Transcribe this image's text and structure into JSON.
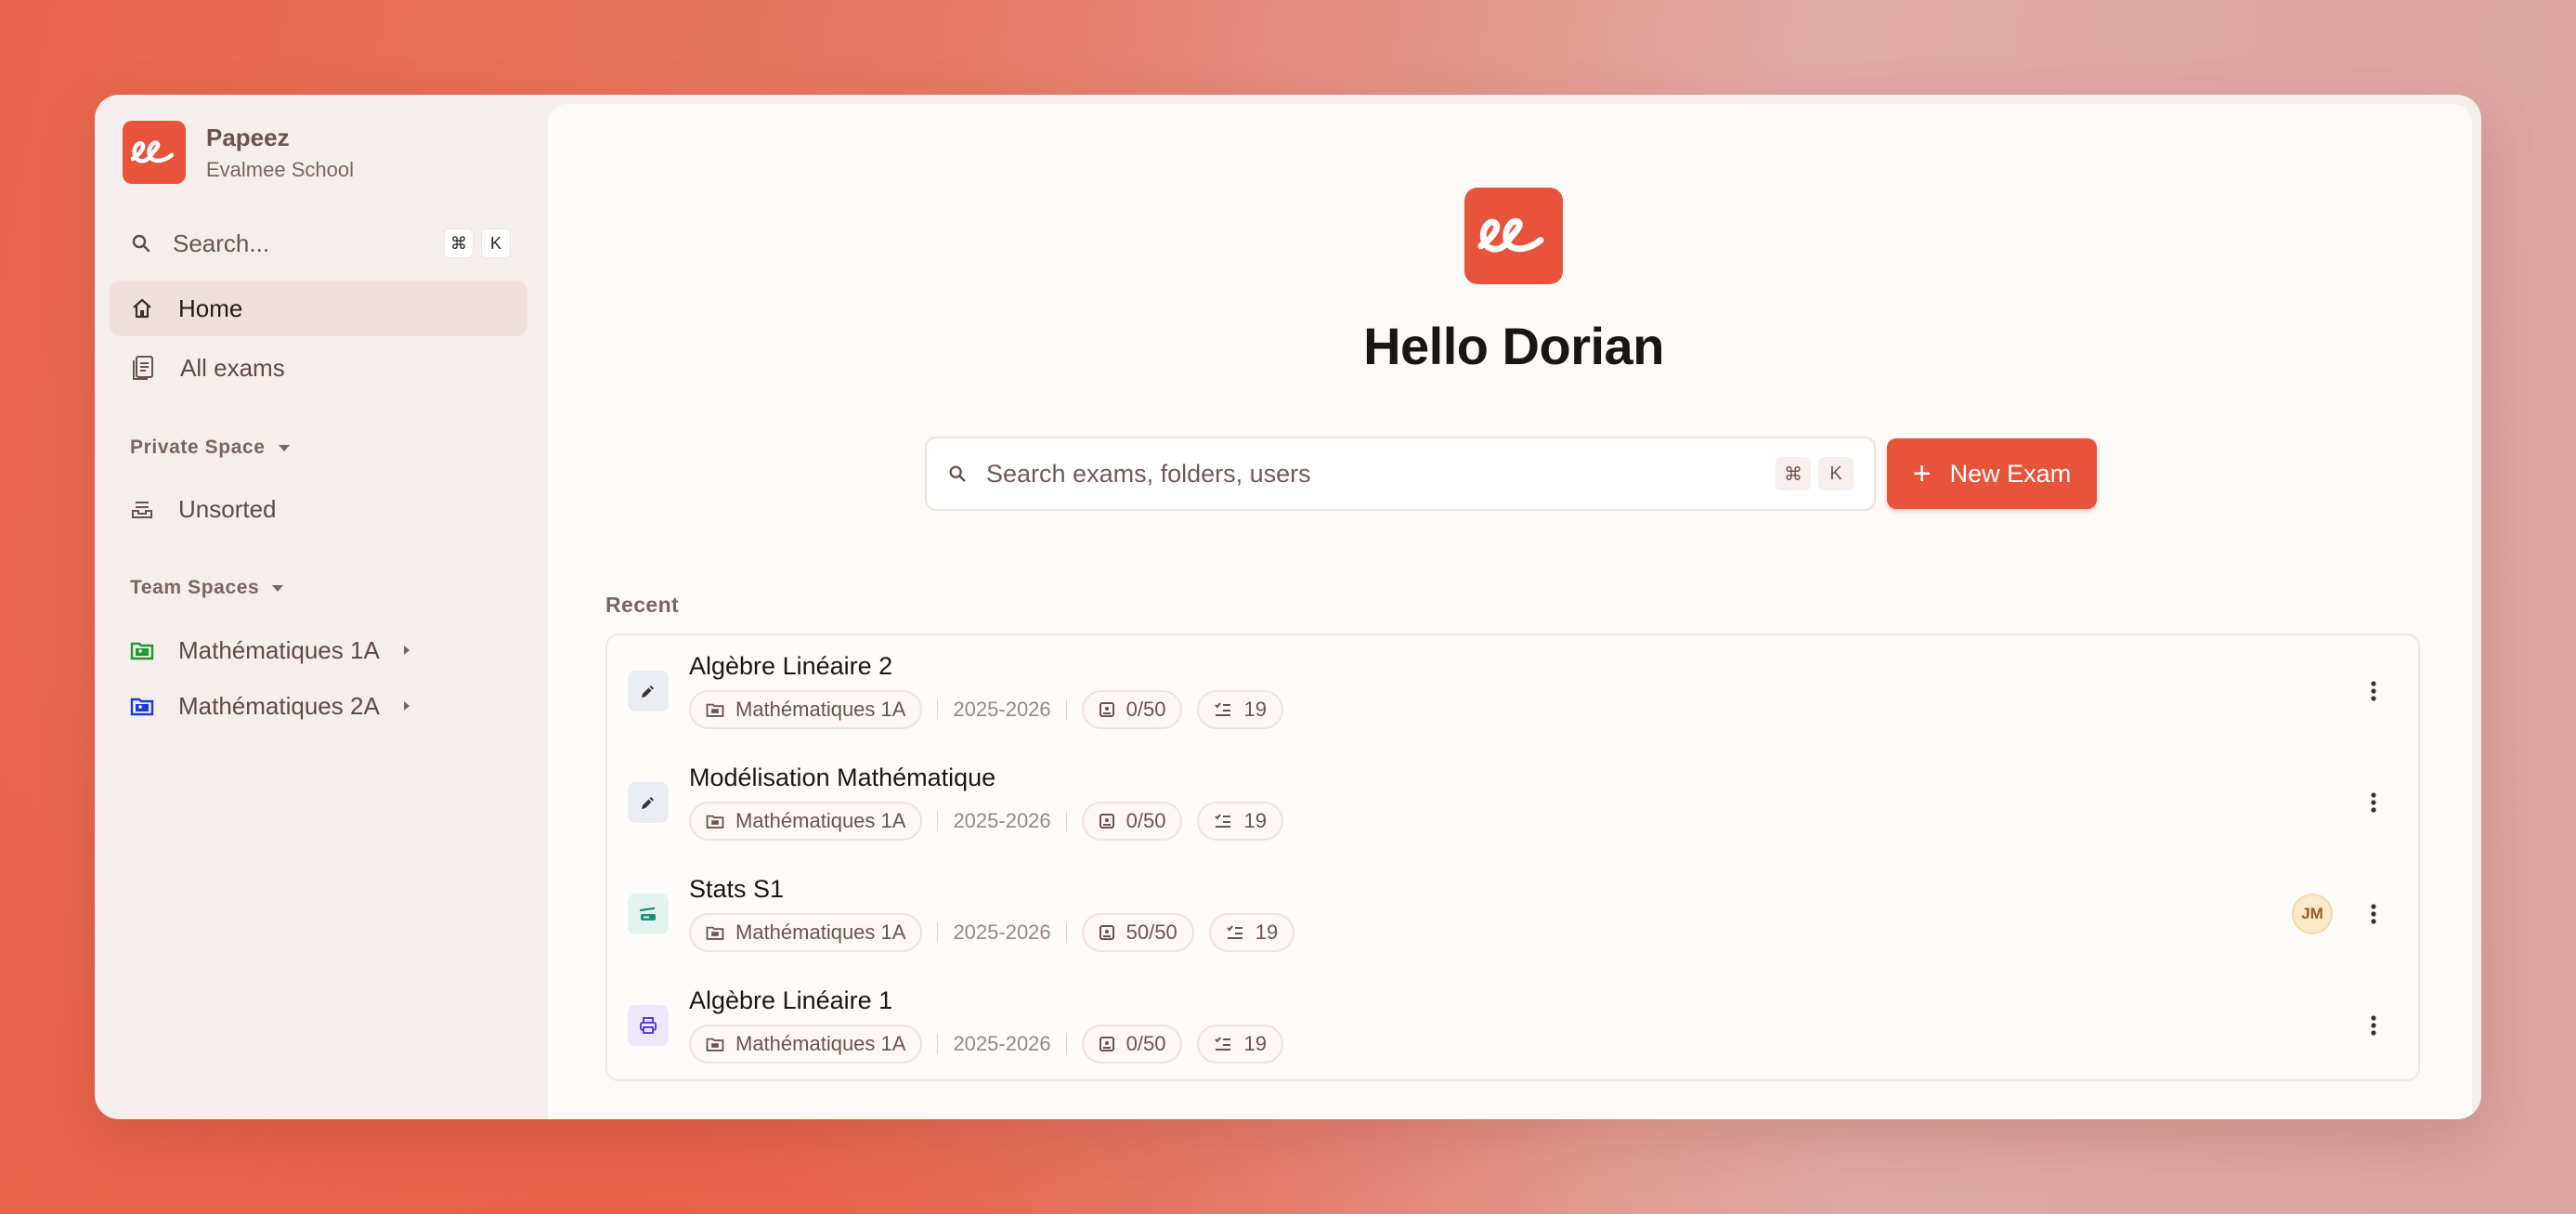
{
  "brand": {
    "name": "Papeez",
    "school": "Evalmee School"
  },
  "sidebar": {
    "search": {
      "label": "Search...",
      "kbd_mod": "⌘",
      "kbd_key": "K"
    },
    "nav": [
      {
        "label": "Home",
        "icon": "home-icon",
        "active": true
      },
      {
        "label": "All exams",
        "icon": "document-icon",
        "active": false
      }
    ],
    "private_space": {
      "title": "Private Space",
      "items": [
        {
          "label": "Unsorted",
          "icon": "inbox-stack-icon"
        }
      ]
    },
    "team_spaces": {
      "title": "Team Spaces",
      "items": [
        {
          "label": "Mathématiques 1A",
          "icon": "folder-user-icon",
          "color": "#1f9a2e"
        },
        {
          "label": "Mathématiques 2A",
          "icon": "folder-user-icon",
          "color": "#1a3ad6"
        }
      ]
    }
  },
  "main": {
    "greeting": "Hello Dorian",
    "search": {
      "placeholder": "Search exams, folders, users",
      "kbd_mod": "⌘",
      "kbd_key": "K"
    },
    "new_exam_label": "New Exam",
    "recent_title": "Recent",
    "recent": [
      {
        "title": "Algèbre Linéaire 2",
        "status": "edit",
        "folder": "Mathématiques 1A",
        "year": "2025-2026",
        "copies": "0/50",
        "questions": "19",
        "avatar": ""
      },
      {
        "title": "Modélisation Mathématique",
        "status": "edit",
        "folder": "Mathématiques 1A",
        "year": "2025-2026",
        "copies": "0/50",
        "questions": "19",
        "avatar": ""
      },
      {
        "title": "Stats S1",
        "status": "scan",
        "folder": "Mathématiques 1A",
        "year": "2025-2026",
        "copies": "50/50",
        "questions": "19",
        "avatar": "JM"
      },
      {
        "title": "Algèbre Linéaire 1",
        "status": "print",
        "folder": "Mathématiques 1A",
        "year": "2025-2026",
        "copies": "0/50",
        "questions": "19",
        "avatar": ""
      }
    ]
  },
  "colors": {
    "accent": "#e8533b",
    "edit": "#eaeef2",
    "scan": "#e3f3ef",
    "print": "#ece8fa"
  }
}
